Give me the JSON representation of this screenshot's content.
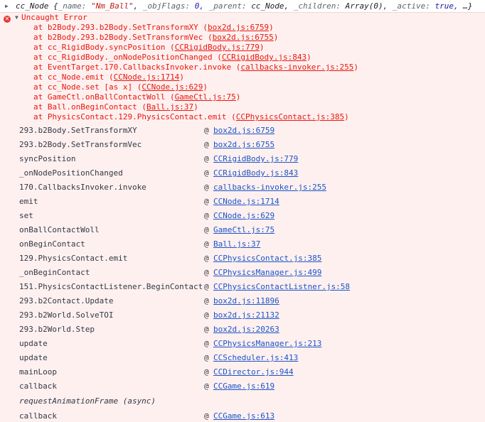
{
  "object_line": {
    "type": "cc_Node",
    "name_key": "_name:",
    "name_val": "\"Nm_Ball\"",
    "flags_key": "_objFlags:",
    "flags_val": "0,",
    "parent_key": "_parent:",
    "parent_val": "cc_Node,",
    "children_key": "_children:",
    "children_val": "Array(0),",
    "active_key": "_active:",
    "active_val": "true,",
    "tail": "…}"
  },
  "error": {
    "title": "Uncaught Error",
    "frames": [
      {
        "text": "at b2Body.293.b2Body.SetTransformXY (",
        "link": "box2d.js:6759",
        "close": ")"
      },
      {
        "text": "at b2Body.293.b2Body.SetTransformVec (",
        "link": "box2d.js:6755",
        "close": ")"
      },
      {
        "text": "at cc_RigidBody.syncPosition (",
        "link": "CCRigidBody.js:779",
        "close": ")"
      },
      {
        "text": "at cc_RigidBody._onNodePositionChanged (",
        "link": "CCRigidBody.js:843",
        "close": ")"
      },
      {
        "text": "at EventTarget.170.CallbacksInvoker.invoke (",
        "link": "callbacks-invoker.js:255",
        "close": ")"
      },
      {
        "text": "at cc_Node.emit (",
        "link": "CCNode.js:1714",
        "close": ")"
      },
      {
        "text": "at cc_Node.set [as x] (",
        "link": "CCNode.js:629",
        "close": ")"
      },
      {
        "text": "at GameCtl.onBallContactWoll (",
        "link": "GameCtl.js:75",
        "close": ")"
      },
      {
        "text": "at Ball.onBeginContact (",
        "link": "Ball.js:37",
        "close": ")"
      },
      {
        "text": "at PhysicsContact.129.PhysicsContact.emit (",
        "link": "CCPhysicsContact.js:385",
        "close": ")"
      }
    ]
  },
  "stack": {
    "at_symbol": "@",
    "rows": [
      {
        "fn": "293.b2Body.SetTransformXY",
        "src": "box2d.js:6759"
      },
      {
        "fn": "293.b2Body.SetTransformVec",
        "src": "box2d.js:6755"
      },
      {
        "fn": "syncPosition",
        "src": "CCRigidBody.js:779"
      },
      {
        "fn": "_onNodePositionChanged",
        "src": "CCRigidBody.js:843"
      },
      {
        "fn": "170.CallbacksInvoker.invoke",
        "src": "callbacks-invoker.js:255"
      },
      {
        "fn": "emit",
        "src": "CCNode.js:1714"
      },
      {
        "fn": "set",
        "src": "CCNode.js:629"
      },
      {
        "fn": "onBallContactWoll",
        "src": "GameCtl.js:75"
      },
      {
        "fn": "onBeginContact",
        "src": "Ball.js:37"
      },
      {
        "fn": "129.PhysicsContact.emit",
        "src": "CCPhysicsContact.js:385"
      },
      {
        "fn": "_onBeginContact",
        "src": "CCPhysicsManager.js:499"
      },
      {
        "fn": "151.PhysicsContactListener.BeginContact",
        "src": "CCPhysicsContactListner.js:58"
      },
      {
        "fn": "293.b2Contact.Update",
        "src": "box2d.js:11896"
      },
      {
        "fn": "293.b2World.SolveTOI",
        "src": "box2d.js:21132"
      },
      {
        "fn": "293.b2World.Step",
        "src": "box2d.js:20263"
      },
      {
        "fn": "update",
        "src": "CCPhysicsManager.js:213"
      },
      {
        "fn": "update",
        "src": "CCScheduler.js:413"
      },
      {
        "fn": "mainLoop",
        "src": "CCDirector.js:944"
      },
      {
        "fn": "callback",
        "src": "CCGame.js:619"
      }
    ],
    "async_label": "requestAnimationFrame (async)",
    "rows_after": [
      {
        "fn": "callback",
        "src": "CCGame.js:613"
      }
    ]
  },
  "icons": {
    "expand": "triangle-right-icon",
    "collapse": "triangle-down-icon",
    "error": "error-circle-icon"
  },
  "colors": {
    "error_bg": "#fff0f0",
    "error_text": "#e8170b",
    "link": "#1a55c8"
  }
}
